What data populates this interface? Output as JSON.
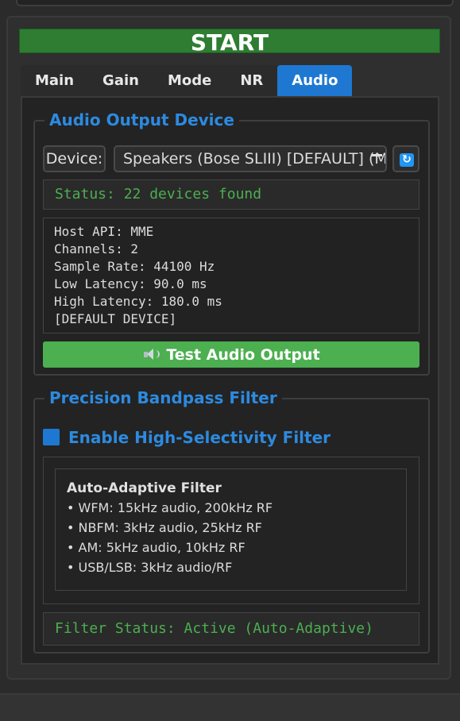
{
  "start_button": "START",
  "tabs": [
    {
      "label": "Main",
      "active": false
    },
    {
      "label": "Gain",
      "active": false
    },
    {
      "label": "Mode",
      "active": false
    },
    {
      "label": "NR",
      "active": false
    },
    {
      "label": "Audio",
      "active": true
    }
  ],
  "audio_output": {
    "group_title": "Audio Output Device",
    "device_label": "Device:",
    "device_value": "Speakers (Bose SLIII) [DEFAULT] (MME)",
    "status": "Status: 22 devices found",
    "info_lines": [
      "Host API: MME",
      "Channels: 2",
      "Sample Rate: 44100 Hz",
      "Low Latency: 90.0 ms",
      "High Latency: 180.0 ms",
      "[DEFAULT DEVICE]"
    ],
    "test_button": "Test Audio Output",
    "refresh_icon": "refresh-icon",
    "speaker_icon": "speaker-icon"
  },
  "bandpass": {
    "group_title": "Precision Bandpass Filter",
    "enable_label": "Enable High-Selectivity Filter",
    "enable_checked": true,
    "filter_heading": "Auto-Adaptive Filter",
    "filter_items": [
      "• WFM: 15kHz audio, 200kHz RF",
      "• NBFM: 3kHz audio, 25kHz RF",
      "• AM: 5kHz audio, 10kHz RF",
      "• USB/LSB: 3kHz audio/RF"
    ],
    "filter_status": "Filter Status: Active (Auto-Adaptive)"
  },
  "colors": {
    "accent": "#1e78d2",
    "start": "#2e7d32",
    "status_text": "#4caf50",
    "test_button": "#4caf50"
  }
}
